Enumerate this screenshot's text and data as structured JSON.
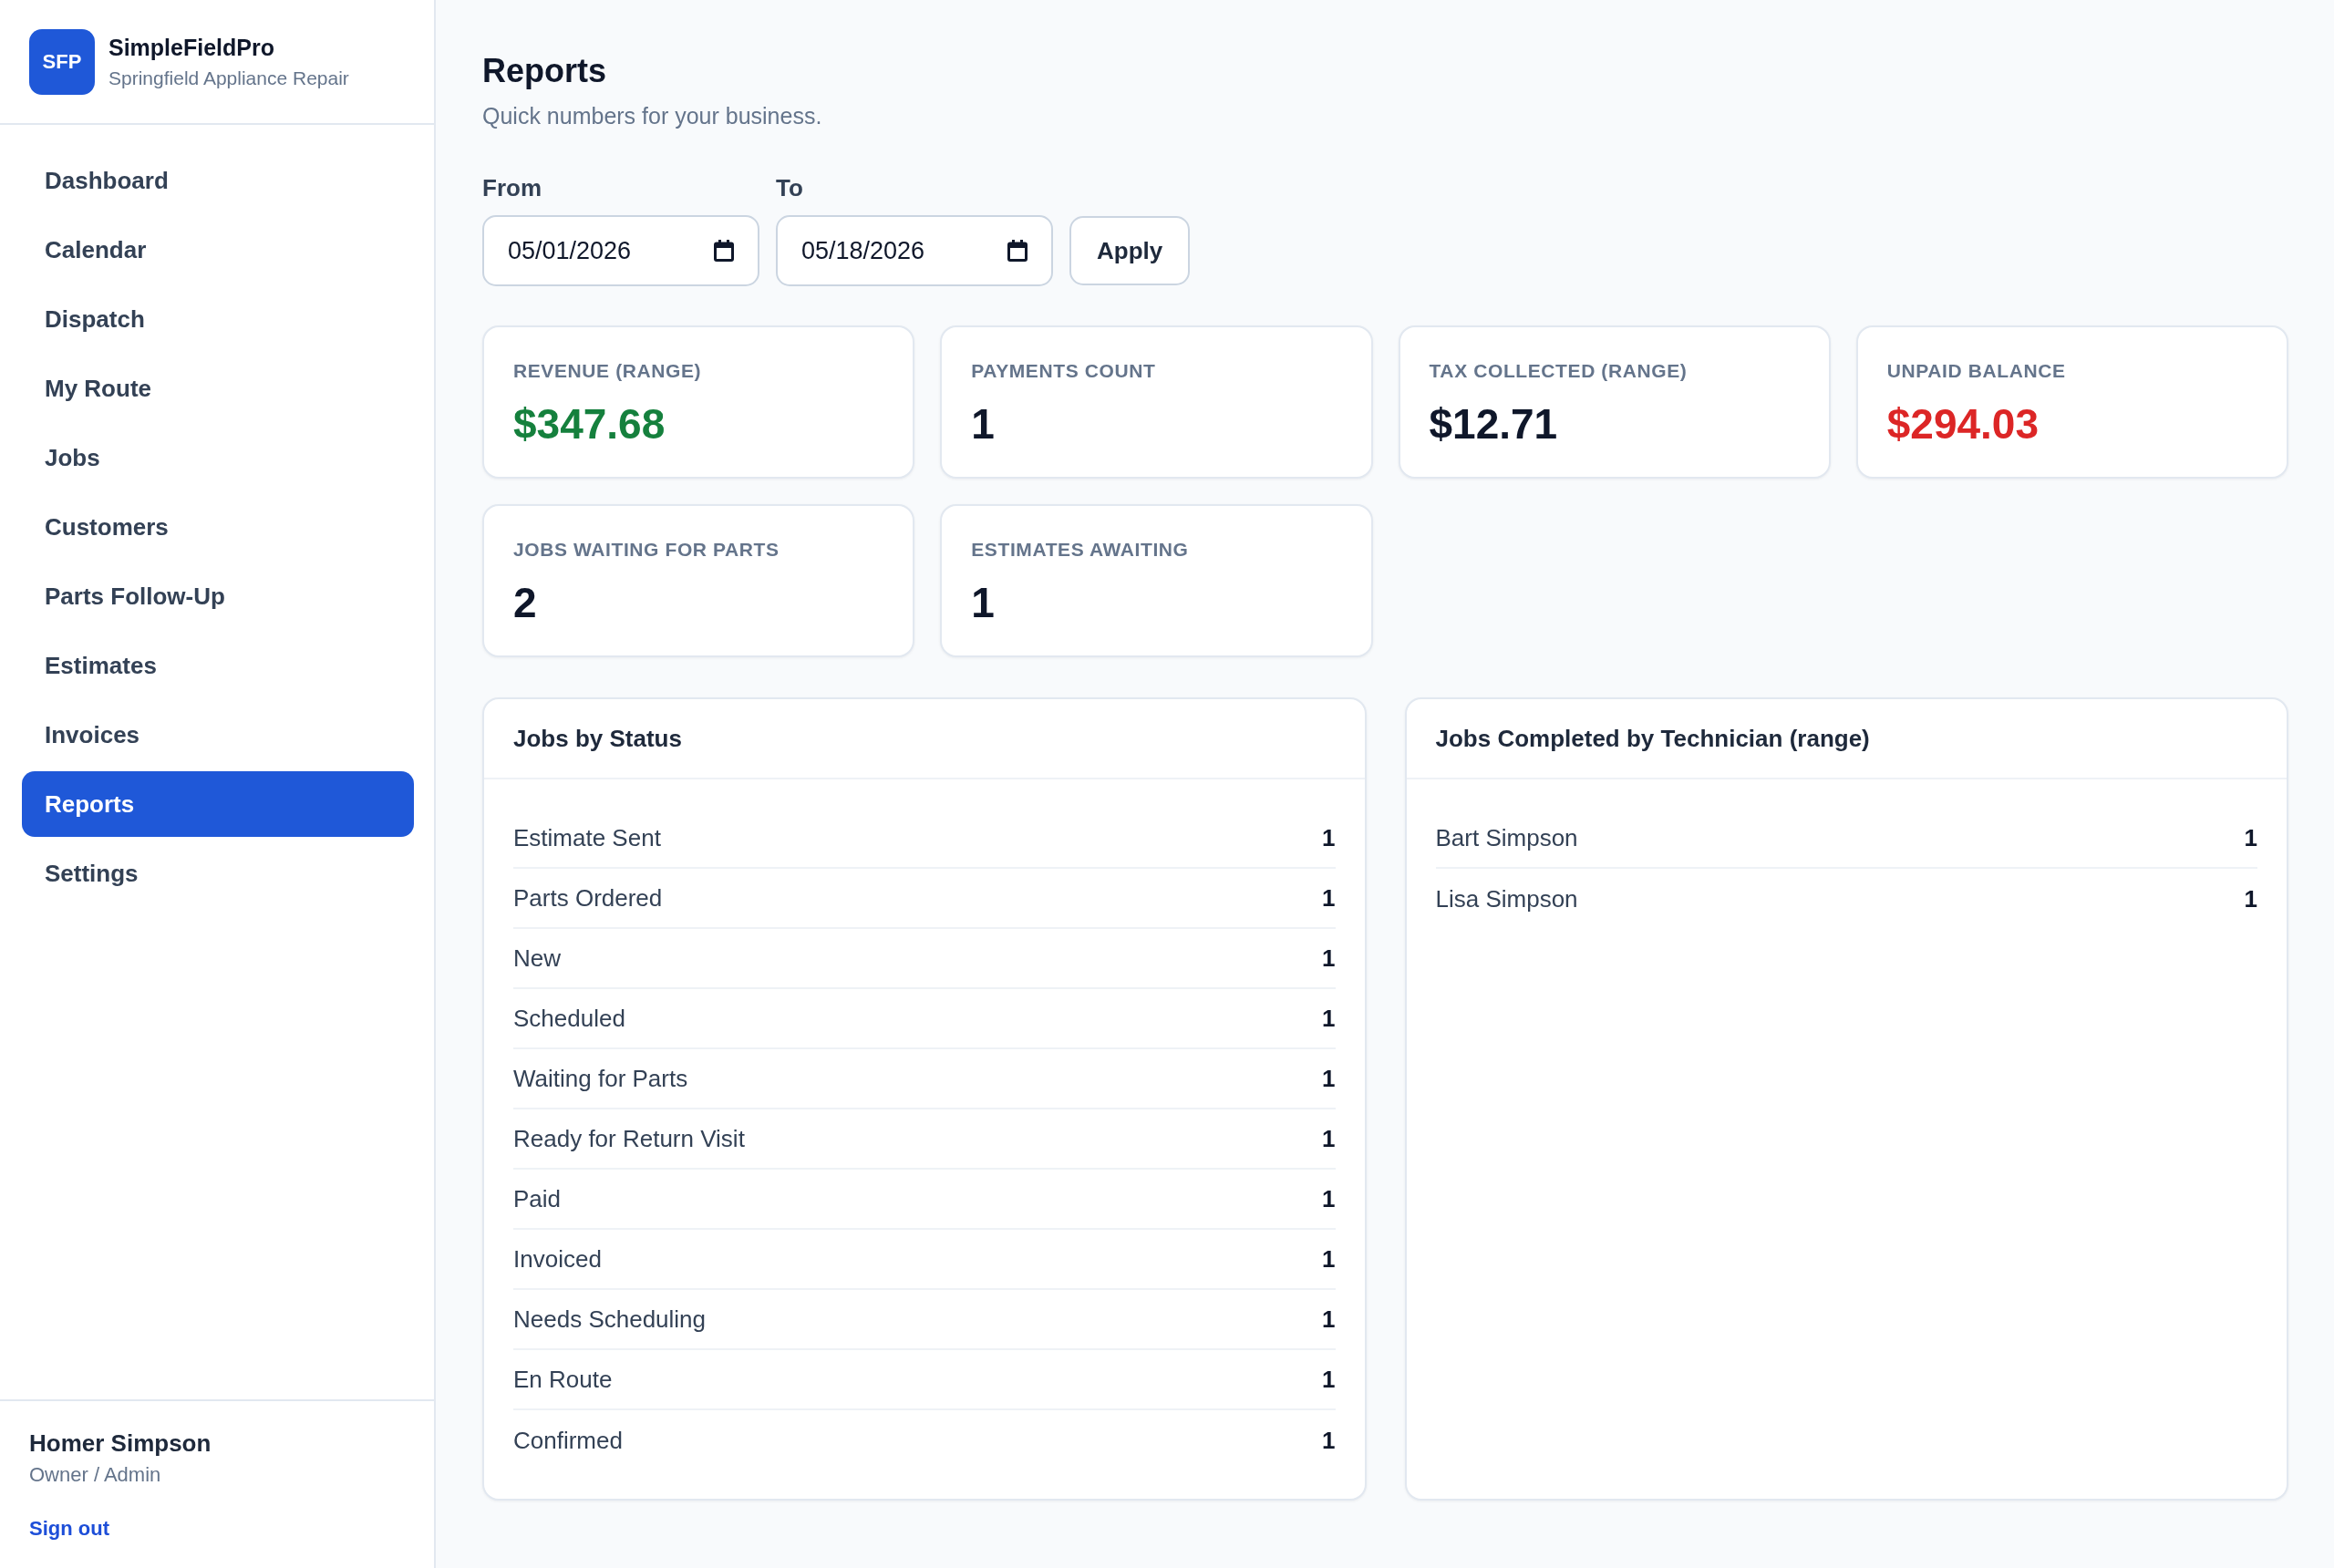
{
  "sidebar": {
    "logo": "SFP",
    "app_name": "SimpleFieldPro",
    "company": "Springfield Appliance Repair",
    "nav": [
      {
        "label": "Dashboard",
        "selected": false
      },
      {
        "label": "Calendar",
        "selected": false
      },
      {
        "label": "Dispatch",
        "selected": false
      },
      {
        "label": "My Route",
        "selected": false
      },
      {
        "label": "Jobs",
        "selected": false
      },
      {
        "label": "Customers",
        "selected": false
      },
      {
        "label": "Parts Follow-Up",
        "selected": false
      },
      {
        "label": "Estimates",
        "selected": false
      },
      {
        "label": "Invoices",
        "selected": false
      },
      {
        "label": "Reports",
        "selected": true
      },
      {
        "label": "Settings",
        "selected": false
      }
    ],
    "user": {
      "name": "Homer Simpson",
      "role": "Owner / Admin"
    },
    "sign_out": "Sign out"
  },
  "page": {
    "title": "Reports",
    "subtitle": "Quick numbers for your business."
  },
  "filters": {
    "from": {
      "label": "From",
      "value": "05/01/2026"
    },
    "to": {
      "label": "To",
      "value": "05/18/2026"
    },
    "apply": "Apply"
  },
  "stats": [
    {
      "label": "REVENUE (RANGE)",
      "value": "$347.68",
      "color": "#15803d"
    },
    {
      "label": "PAYMENTS COUNT",
      "value": "1",
      "color": "#0f172a"
    },
    {
      "label": "TAX COLLECTED (RANGE)",
      "value": "$12.71",
      "color": "#0f172a"
    },
    {
      "label": "UNPAID BALANCE",
      "value": "$294.03",
      "color": "#dc2626"
    },
    {
      "label": "JOBS WAITING FOR PARTS",
      "value": "2",
      "color": "#0f172a"
    },
    {
      "label": "ESTIMATES AWAITING",
      "value": "1",
      "color": "#0f172a"
    }
  ],
  "panels": [
    {
      "title": "Jobs by Status",
      "rows": [
        {
          "label": "Estimate Sent",
          "count": "1"
        },
        {
          "label": "Parts Ordered",
          "count": "1"
        },
        {
          "label": "New",
          "count": "1"
        },
        {
          "label": "Scheduled",
          "count": "1"
        },
        {
          "label": "Waiting for Parts",
          "count": "1"
        },
        {
          "label": "Ready for Return Visit",
          "count": "1"
        },
        {
          "label": "Paid",
          "count": "1"
        },
        {
          "label": "Invoiced",
          "count": "1"
        },
        {
          "label": "Needs Scheduling",
          "count": "1"
        },
        {
          "label": "En Route",
          "count": "1"
        },
        {
          "label": "Confirmed",
          "count": "1"
        }
      ]
    },
    {
      "title": "Jobs Completed by Technician (range)",
      "rows": [
        {
          "label": "Bart Simpson",
          "count": "1"
        },
        {
          "label": "Lisa Simpson",
          "count": "1"
        }
      ]
    }
  ]
}
